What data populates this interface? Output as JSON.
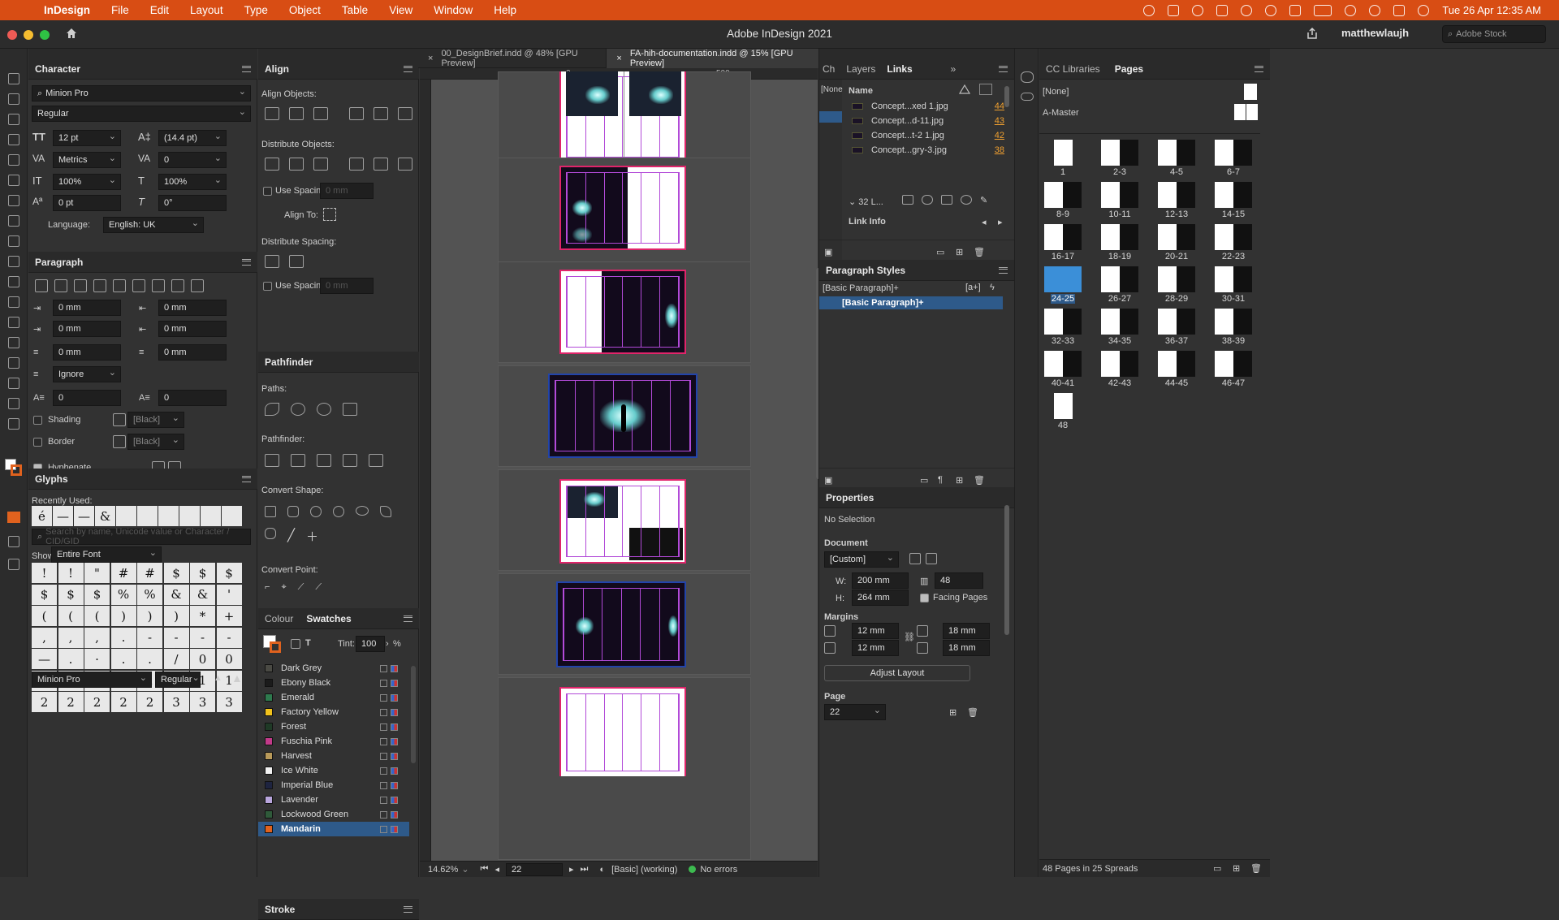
{
  "menubar": {
    "app": "InDesign",
    "items": [
      "File",
      "Edit",
      "Layout",
      "Type",
      "Object",
      "Table",
      "View",
      "Window",
      "Help"
    ],
    "datetime": "Tue 26 Apr  12:35 AM"
  },
  "window": {
    "title": "Adobe InDesign 2021",
    "user": "matthewlaujh",
    "stock_placeholder": "Adobe Stock"
  },
  "doc_tabs": [
    {
      "label": "00_DesignBrief.indd @ 48% [GPU Preview]"
    },
    {
      "label": "FA-hih-documentation.indd @ 15% [GPU Preview]"
    }
  ],
  "ruler": {
    "t0": "0",
    "t500": "500"
  },
  "character": {
    "title": "Character",
    "font": "Minion Pro",
    "style": "Regular",
    "size": "12 pt",
    "leading": "(14.4 pt)",
    "kerning": "Metrics",
    "tracking": "0",
    "vscale": "100%",
    "hscale": "100%",
    "baseline": "0 pt",
    "skew": "0°",
    "language_label": "Language:",
    "language": "English: UK"
  },
  "paragraph": {
    "title": "Paragraph",
    "left_indent": "0 mm",
    "right_indent": "0 mm",
    "first_indent": "0 mm",
    "last_indent": "0 mm",
    "space_before": "0 mm",
    "space_after": "0 mm",
    "grid": "Ignore",
    "drop_lines": "0",
    "drop_chars": "0",
    "shading": "Shading",
    "border": "Border",
    "shading_color": "[Black]",
    "border_color": "[Black]",
    "hyphenate": "Hyphenate"
  },
  "glyphs": {
    "title": "Glyphs",
    "recent_label": "Recently Used:",
    "recent": [
      "é",
      "—",
      "—",
      "&"
    ],
    "search_placeholder": "Search by name, Unicode value or Character / CID/GID",
    "show_label": "Show:",
    "show": "Entire Font",
    "grid": [
      "!",
      "!",
      "\"",
      "#",
      "#",
      "$",
      "$",
      "$",
      "$",
      "$",
      "$",
      "%",
      "%",
      "&",
      "&",
      "'",
      "(",
      "(",
      "(",
      ")",
      ")",
      ")",
      "*",
      "+",
      ",",
      ",",
      ",",
      ".",
      "-",
      "-",
      "-",
      "-",
      "—",
      ".",
      "·",
      ".",
      ".",
      "/",
      "0",
      "0",
      "0",
      "0",
      "0",
      "1",
      "1",
      "1",
      "1",
      "1",
      "2",
      "2",
      "2",
      "2",
      "2",
      "3",
      "3",
      "3"
    ],
    "font": "Minion Pro",
    "style": "Regular"
  },
  "align": {
    "title": "Align",
    "align_objects": "Align Objects:",
    "distribute_objects": "Distribute Objects:",
    "use_spacing": "Use Spacing",
    "use_spacing_value": "0 mm",
    "align_to": "Align To:",
    "distribute_spacing": "Distribute Spacing:",
    "use_spacing2": "Use Spacing",
    "use_spacing_value2": "0 mm"
  },
  "pathfinder": {
    "title": "Pathfinder",
    "paths": "Paths:",
    "pathfinder": "Pathfinder:",
    "convert_shape": "Convert Shape:",
    "convert_point": "Convert Point:"
  },
  "swatches": {
    "tab_colour": "Colour",
    "tab_swatches": "Swatches",
    "tint_label": "Tint:",
    "tint": "100",
    "pct": "%",
    "items": [
      {
        "name": "Dark Grey",
        "color": "#4a4a44"
      },
      {
        "name": "Ebony Black",
        "color": "#1b1b1b"
      },
      {
        "name": "Emerald",
        "color": "#2e7a4e"
      },
      {
        "name": "Factory Yellow",
        "color": "#f2c31c"
      },
      {
        "name": "Forest",
        "color": "#1f3a26"
      },
      {
        "name": "Fuschia Pink",
        "color": "#c23a8a"
      },
      {
        "name": "Harvest",
        "color": "#b89a5a"
      },
      {
        "name": "Ice White",
        "color": "#f2f2f2"
      },
      {
        "name": "Imperial Blue",
        "color": "#1e2440"
      },
      {
        "name": "Lavender",
        "color": "#b9a6dd"
      },
      {
        "name": "Lockwood Green",
        "color": "#2f5a3a"
      },
      {
        "name": "Mandarin",
        "color": "#e0621e"
      }
    ],
    "selected": "Mandarin"
  },
  "stroke": {
    "title": "Stroke"
  },
  "status": {
    "zoom": "14.62%",
    "page": "22",
    "style": "[Basic] (working)",
    "errors": "No errors"
  },
  "links": {
    "tab_ch": "Ch",
    "tab_layers": "Layers",
    "tab_links": "Links",
    "none": "[None",
    "name_col": "Name",
    "rows": [
      {
        "name": "Concept...xed 1.jpg",
        "page": "44"
      },
      {
        "name": "Concept...d-11.jpg",
        "page": "43"
      },
      {
        "name": "Concept...t-2 1.jpg",
        "page": "42"
      },
      {
        "name": "Concept...gry-3.jpg",
        "page": "38"
      }
    ],
    "group": "32 L...",
    "link_info": "Link Info"
  },
  "para_styles": {
    "title": "Paragraph Styles",
    "current": "[Basic Paragraph]+",
    "selected": "[Basic Paragraph]+"
  },
  "properties": {
    "title": "Properties",
    "no_selection": "No Selection",
    "document": "Document",
    "preset": "[Custom]",
    "w_label": "W:",
    "w": "200 mm",
    "h_label": "H:",
    "h": "264 mm",
    "pages": "48",
    "facing": "Facing Pages",
    "margins": "Margins",
    "m_top": "12 mm",
    "m_bottom": "12 mm",
    "m_in": "18 mm",
    "m_out": "18 mm",
    "adjust": "Adjust Layout",
    "page": "Page",
    "page_value": "22"
  },
  "pages": {
    "tab_cc": "CC Libraries",
    "tab_pages": "Pages",
    "none": "[None]",
    "master": "A-Master",
    "footer": "48 Pages in 25 Spreads",
    "thumbs": [
      "1",
      "2-3",
      "4-5",
      "6-7",
      "8-9",
      "10-11",
      "12-13",
      "14-15",
      "16-17",
      "18-19",
      "20-21",
      "22-23",
      "24-25",
      "26-27",
      "28-29",
      "30-31",
      "32-33",
      "34-35",
      "36-37",
      "38-39",
      "40-41",
      "42-43",
      "44-45",
      "46-47",
      "48"
    ],
    "selected": "24-25"
  }
}
